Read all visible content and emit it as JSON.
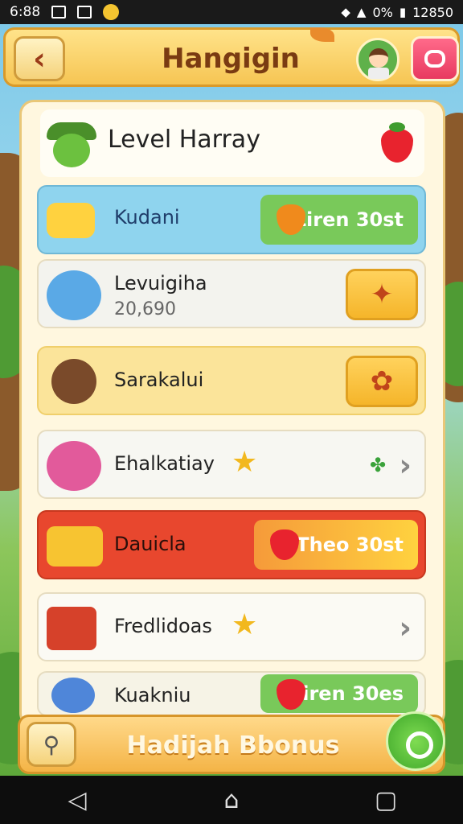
{
  "status_bar": {
    "time": "6:88",
    "battery": "0%",
    "clock": "12850"
  },
  "header": {
    "title": "Hangigin"
  },
  "panel": {
    "title": "Level Harray"
  },
  "rows": [
    {
      "label": "Kudani",
      "pill": "Liren 30st"
    },
    {
      "label": "Levuigiha",
      "sub": "20,690"
    },
    {
      "label": "Sarakalui"
    },
    {
      "label": "Ehalkatiay"
    },
    {
      "label": "Dauicla",
      "pill": "Theo 30st"
    },
    {
      "label": "Fredlidoas"
    },
    {
      "label": "Kuakniu",
      "pill": "Liren 30es"
    }
  ],
  "bottom_bar": {
    "title": "Hadijah Bbonus"
  },
  "colors": {
    "accent": "#f6c553",
    "red_row": "#e8472e",
    "blue_row": "#8fd4ee",
    "green_pill": "#79c95a"
  },
  "icons": {
    "back": "chevron-left-icon",
    "search": "search-icon",
    "chat": "chat-icon"
  }
}
